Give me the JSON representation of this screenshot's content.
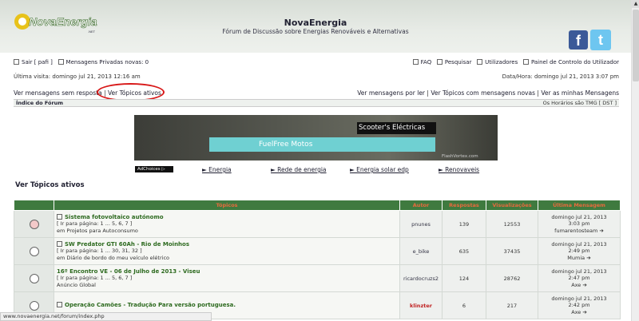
{
  "header": {
    "title": "NovaEnergia",
    "subtitle": "Fórum de Discussão sobre Energias Renováveis e Alternativas",
    "logo_text": "NovaEnergia",
    "logo_sub": ".NET",
    "facebook_glyph": "f",
    "twitter_glyph": "t"
  },
  "user_bar": {
    "logout": "Sair [ pafi ]",
    "pm": "Mensagens Privadas novas: 0",
    "faq": "FAQ",
    "search": "Pesquisar",
    "users": "Utilizadores",
    "control_panel": "Painel de Controlo do Utilizador"
  },
  "visit": {
    "last_visit": "Última visita: domingo jul 21, 2013 12:16 am",
    "datetime": "Data/Hora: domingo jul 21, 2013 3:07 pm"
  },
  "links": {
    "unanswered": "Ver mensagens sem resposta",
    "active": "Ver Tópicos ativos",
    "sep": "|",
    "unread": "Ver mensagens por ler",
    "new_posts": "Ver Tópicos com mensagens novas",
    "own_posts": "Ver as minhas Mensagens"
  },
  "navbar": {
    "index": "Índice do Fórum",
    "timezone": "Os Horários são TMG [ DST ]"
  },
  "ad": {
    "scooters": "Scooter's Eléctricas",
    "fuelfree": "FuelFree Motos",
    "flashvortex": "FlashVortex.com",
    "adchoices": "AdChoices ▷",
    "links": [
      "► Energia",
      "► Rede de energia",
      "► Energia solar edp",
      "► Renovaveis"
    ]
  },
  "section_title": "Ver Tópicos ativos",
  "table": {
    "headers": [
      "Tópicos",
      "Autor",
      "Respostas",
      "Visualizações",
      "Última Mensagem"
    ],
    "rows": [
      {
        "title": "Sistema fotovoltaico autónomo",
        "pages": "[ Ir para página: 1 ... 5, 6, 7 ]",
        "forum": "em Projetos para Autoconsumo",
        "author": "pnunes",
        "replies": "139",
        "views": "12553",
        "last_date": "domingo jul 21, 2013",
        "last_time": "3:03 pm",
        "last_user": "fumarentosteam"
      },
      {
        "title": "SW Predator GTI 60Ah - Rio de Moinhos",
        "pages": "[ Ir para página: 1 ... 30, 31, 32 ]",
        "forum": "em Diário de bordo do meu veículo elétrico",
        "author": "e_bike",
        "replies": "635",
        "views": "37435",
        "last_date": "domingo jul 21, 2013",
        "last_time": "2:49 pm",
        "last_user": "Mumia"
      },
      {
        "title": "16º Encontro VE - 06 de Julho de 2013 - Viseu",
        "pages": "[ Ir para página: 1 ... 5, 6, 7 ]",
        "forum": "Anúncio Global",
        "author": "ricardocruzs2",
        "replies": "124",
        "views": "28762",
        "last_date": "domingo jul 21, 2013",
        "last_time": "2:47 pm",
        "last_user": "Axe"
      },
      {
        "title": "Operação Camões - Tradução Para versão portuguesa.",
        "pages": "",
        "forum": "",
        "author": "klinzter",
        "replies": "6",
        "views": "217",
        "last_date": "domingo jul 21, 2013",
        "last_time": "2:42 pm",
        "last_user": "Axe"
      }
    ]
  },
  "statusbar": "www.novaenergia.net/forum/index.php"
}
